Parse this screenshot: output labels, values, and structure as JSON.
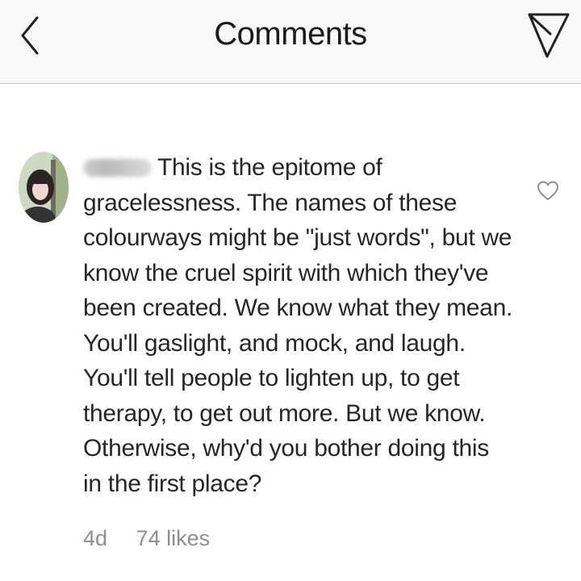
{
  "header": {
    "title": "Comments",
    "back_icon": "chevron-left-icon",
    "send_icon": "paper-plane-icon"
  },
  "comment": {
    "text_first_line": "This is the epitome of",
    "text_rest": "gracelessness. The names of these\ncolourways might be \"just words\", but we\nknow the cruel spirit with which they've\nbeen created. We know what they mean.\nYou'll gaslight, and mock, and laugh.\nYou'll tell people to lighten up, to get\ntherapy, to get out more. But we know.\nOtherwise, why'd you bother doing this\nin the first place?",
    "age": "4d",
    "likes": "74 likes",
    "like_icon": "heart-outline-icon"
  },
  "colors": {
    "header_bg": "#f8f8f8",
    "text": "#262626",
    "meta": "#8e8e8e",
    "icon": "#222222"
  }
}
